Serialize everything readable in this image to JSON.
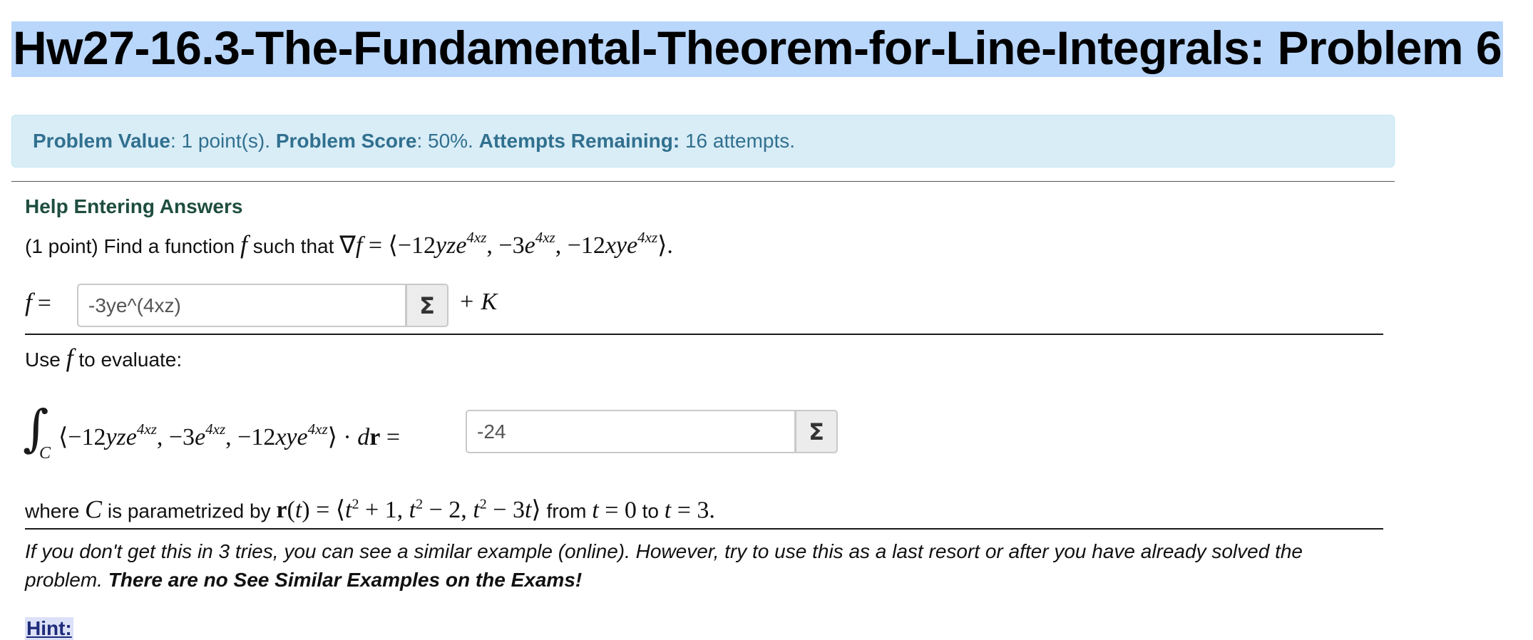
{
  "page": {
    "title": "Hw27-16.3-The-Fundamental-Theorem-for-Line-Integrals: Problem 6"
  },
  "problem_info": {
    "value_label": "Problem Value",
    "value_text": ": 1 point(s). ",
    "score_label": "Problem Score",
    "score_text": ": 50%. ",
    "attempts_label": "Attempts Remaining:",
    "attempts_text": " 16 attempts."
  },
  "problem": {
    "help_link": "Help Entering Answers",
    "intro_text": "(1 point) Find a function",
    "such_that": "such that",
    "use_f_text_before": "Use",
    "use_f_text_after": "to evaluate:",
    "where_text": "where",
    "parametrized_text": "is parametrized by",
    "from_text": "from",
    "to_text": "to",
    "plus_k": "+ K",
    "answers": [
      {
        "value": "-3ye^(4xz)"
      },
      {
        "value": "-24"
      }
    ],
    "equation_button_symbol": "Σ"
  },
  "note": {
    "italic_text": "If you don't get this in 3 tries, you can see a similar example (online). However, try to use this as a last resort or after you have already solved the problem. ",
    "bold_text": "There are no See Similar Examples on the Exams!"
  },
  "hint": {
    "label": "Hint:"
  },
  "colors": {
    "info_bg": "#d9edf7",
    "info_text": "#31708f",
    "title_selection": "#b9d6fb",
    "help_link": "#1e4d3f",
    "hint_link": "#1e2b7a"
  }
}
